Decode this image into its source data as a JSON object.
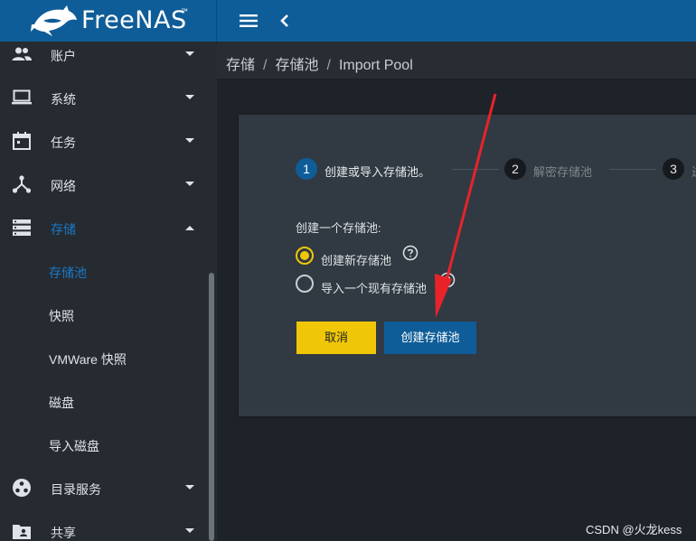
{
  "app": {
    "logo_text": "FreeNAS",
    "trademark": "™"
  },
  "colors": {
    "topbar": "#0f5d98",
    "accent": "#1b78c7",
    "cancel_button": "#f0c707",
    "primary_button": "#0f5d98",
    "annotation_arrow": "#e8232a"
  },
  "sidebar": {
    "items": [
      {
        "label": "账户",
        "icon": "account-group-icon",
        "caret": "down"
      },
      {
        "label": "系统",
        "icon": "laptop-icon",
        "caret": "down"
      },
      {
        "label": "任务",
        "icon": "calendar-icon",
        "caret": "down"
      },
      {
        "label": "网络",
        "icon": "network-icon",
        "caret": "down"
      },
      {
        "label": "存储",
        "icon": "storage-icon",
        "caret": "up"
      },
      {
        "label": "目录服务",
        "icon": "directory-services-icon",
        "caret": "down"
      },
      {
        "label": "共享",
        "icon": "share-folder-icon",
        "caret": "down"
      }
    ],
    "storage_children": [
      "存储池",
      "快照",
      "VMWare 快照",
      "磁盘",
      "导入磁盘"
    ],
    "active_child": "存储池"
  },
  "breadcrumb": [
    "存储",
    "存储池",
    "Import Pool"
  ],
  "stepper": {
    "steps": [
      {
        "number": "1",
        "label": "创建或导入存储池。",
        "state": "active"
      },
      {
        "number": "2",
        "label": "解密存储池",
        "state": "inactive"
      },
      {
        "number": "3",
        "label": "进",
        "state": "inactive"
      }
    ]
  },
  "form": {
    "heading": "创建一个存储池:",
    "options": [
      {
        "label": "创建新存储池",
        "selected": true
      },
      {
        "label": "导入一个现有存储池",
        "selected": false
      }
    ]
  },
  "buttons": {
    "cancel": "取消",
    "create": "创建存储池"
  },
  "watermark": "CSDN @火龙kess"
}
